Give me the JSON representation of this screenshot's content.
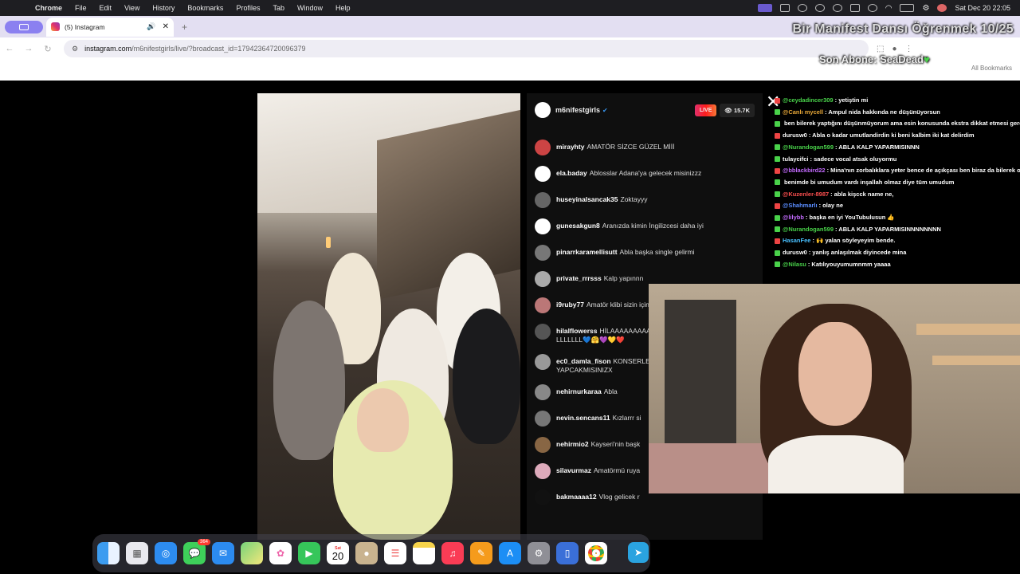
{
  "menubar": {
    "app_name": "Chrome",
    "items": [
      "File",
      "Edit",
      "View",
      "History",
      "Bookmarks",
      "Profiles",
      "Tab",
      "Window",
      "Help"
    ],
    "clock": "Sat Dec 20  22:05"
  },
  "browser": {
    "tab_title": "(5) Instagram",
    "url_host": "instagram.com",
    "url_path": "/m6nifestgirls/live/?broadcast_id=17942364720096379",
    "all_bookmarks": "All Bookmarks"
  },
  "overlay": {
    "title": "Bir Manifest Dansı Öğrenmek 10/25",
    "subscriber": "Son Abone: SeaDead"
  },
  "live": {
    "account": "m6nifestgirls",
    "live_label": "LIVE",
    "viewers": "15.7K",
    "comments": [
      {
        "user": "mirayhty",
        "text": "AMATÖR SİZCE GÜZEL Mİİİ",
        "color": "#c44"
      },
      {
        "user": "ela.baday",
        "text": "Ablosslar Adana'ya gelecek misinizzz",
        "color": "#fff"
      },
      {
        "user": "huseyinalsancak35",
        "text": "Zoktayyy",
        "color": "#666"
      },
      {
        "user": "gunesakgun8",
        "text": "Aranızda kimin İngilizcesi daha iyi",
        "color": "#fff"
      },
      {
        "user": "pinarrkaramellisutt",
        "text": "Abla başka single gelirmi",
        "color": "#777"
      },
      {
        "user": "private_rrrsss",
        "text": "Kalp yapınnn",
        "color": "#aaa"
      },
      {
        "user": "i9ruby77",
        "text": "Amatör klibi sizin için nasıl bir süreçti",
        "color": "#b77"
      },
      {
        "user": "hilalflowerss",
        "text": "HİLAAAAAAAAAAAAAAAAAAAAAAAAAAAAL LLLLLLL💙🤗💜💛❤️",
        "color": "#555"
      },
      {
        "user": "ec0_damla_fison",
        "text": "KONSERLER GELCEKMİİİİİİİİİİİİİİİİ KONSER YAPCAKMISINIZX",
        "color": "#999"
      },
      {
        "user": "nehirnurkaraa",
        "text": "Abla",
        "color": "#888"
      },
      {
        "user": "nevin.sencans11",
        "text": "Kızlarrr si",
        "color": "#777"
      },
      {
        "user": "nehirmio2",
        "text": "Kayseri'nin başk",
        "color": "#864"
      },
      {
        "user": "silavurmaz",
        "text": "Amatörmü ruya",
        "color": "#dab"
      },
      {
        "user": "bakmaaaa12",
        "text": "Vlog gelicek r",
        "color": "#111"
      }
    ]
  },
  "twitch_chat": [
    {
      "user": "@ceydadincer309",
      "text": ": yetiştin mi",
      "ucolor": "#49d24a"
    },
    {
      "user": "@Canlı mycell",
      "text": ": Ampul nida hakkında ne düşünüyorsun",
      "ucolor": "#e8a838"
    },
    {
      "user": "",
      "text": "ben bilerek yaptığını düşünmüyorum ama esin konusunda ekstra dikkat etmesi gerektiğini düşünüyorum",
      "ucolor": "#9aa0ff"
    },
    {
      "user": "durusw0",
      "text": ": Abla o kadar umutlandirdin ki beni kalbim iki kat delirdim",
      "ucolor": "#fff"
    },
    {
      "user": "@Nurandogan599",
      "text": ": ABLA KALP YAPARMISINNN",
      "ucolor": "#49d24a"
    },
    {
      "user": "tulaycifci",
      "text": ": sadece vocal atsak oluyormu",
      "ucolor": "#fff"
    },
    {
      "user": "@bblackbird22",
      "text": ": Mina'nın zorbalıklara yeter bence de açıkçası ben biraz da bilerek olabilen",
      "ucolor": "#c46bff"
    },
    {
      "user": "",
      "text": "benimde bi umudum vardı inşallah olmaz diye tüm umudum",
      "ucolor": "#fff"
    },
    {
      "user": "@Kuzenler-8987",
      "text": ": abla kişcck name ne,",
      "ucolor": "#ff5050"
    },
    {
      "user": "@Shahmarlı",
      "text": ": olay ne",
      "ucolor": "#5a8dff"
    },
    {
      "user": "@lilybb",
      "text": ": başka en iyi YouTubulusun 👍",
      "ucolor": "#c46bff"
    },
    {
      "user": "@Nurandogan599",
      "text": ": ABLA KALP YAPARMISINNNNNNNN",
      "ucolor": "#49d24a"
    },
    {
      "user": "HasanFee",
      "text": ": 🙌 yalan söyleyeyim bende.",
      "ucolor": "#49c0ff"
    },
    {
      "user": "durusw0",
      "text": ": yanlış anlaşılmak diyincede mina",
      "ucolor": "#fff"
    },
    {
      "user": "@Nilasu",
      "text": ": Katılıyouyumumnmm yaaaa",
      "ucolor": "#49d24a"
    }
  ],
  "dock": {
    "messages_badge": "364",
    "calendar_month": "Sat",
    "calendar_day": "20"
  }
}
